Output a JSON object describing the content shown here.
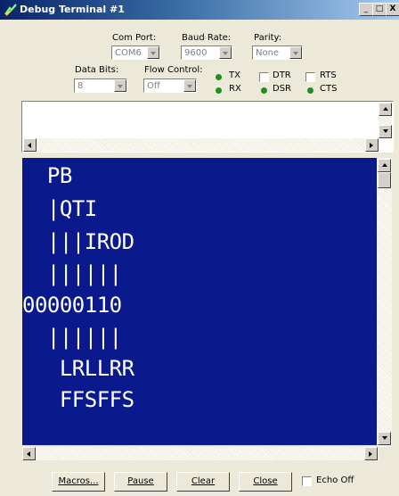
{
  "window": {
    "title": "Debug Terminal #1",
    "minimize": "_",
    "maximize": "□",
    "close": "X"
  },
  "settings": {
    "com_port_label": "Com Port:",
    "com_port_value": "COM6",
    "baud_rate_label": "Baud Rate:",
    "baud_rate_value": "9600",
    "parity_label": "Parity:",
    "parity_value": "None",
    "data_bits_label": "Data Bits:",
    "data_bits_value": "8",
    "flow_control_label": "Flow Control:",
    "flow_control_value": "Off"
  },
  "signals": {
    "tx": "TX",
    "rx": "RX",
    "dtr": "DTR",
    "dsr": "DSR",
    "rts": "RTS",
    "cts": "CTS",
    "led_color": "#1f8f1f"
  },
  "terminal": {
    "background": "#0a1a8c",
    "lines": [
      "  PB",
      "  |QTI",
      "  |||IROD",
      "  ||||||",
      "00000110",
      "  ||||||",
      "   LRLLRR",
      "   FFSFFS"
    ]
  },
  "buttons": {
    "macros": "Macros...",
    "pause": "Pause",
    "clear": "Clear",
    "close": "Close",
    "echo_off": "Echo Off"
  }
}
